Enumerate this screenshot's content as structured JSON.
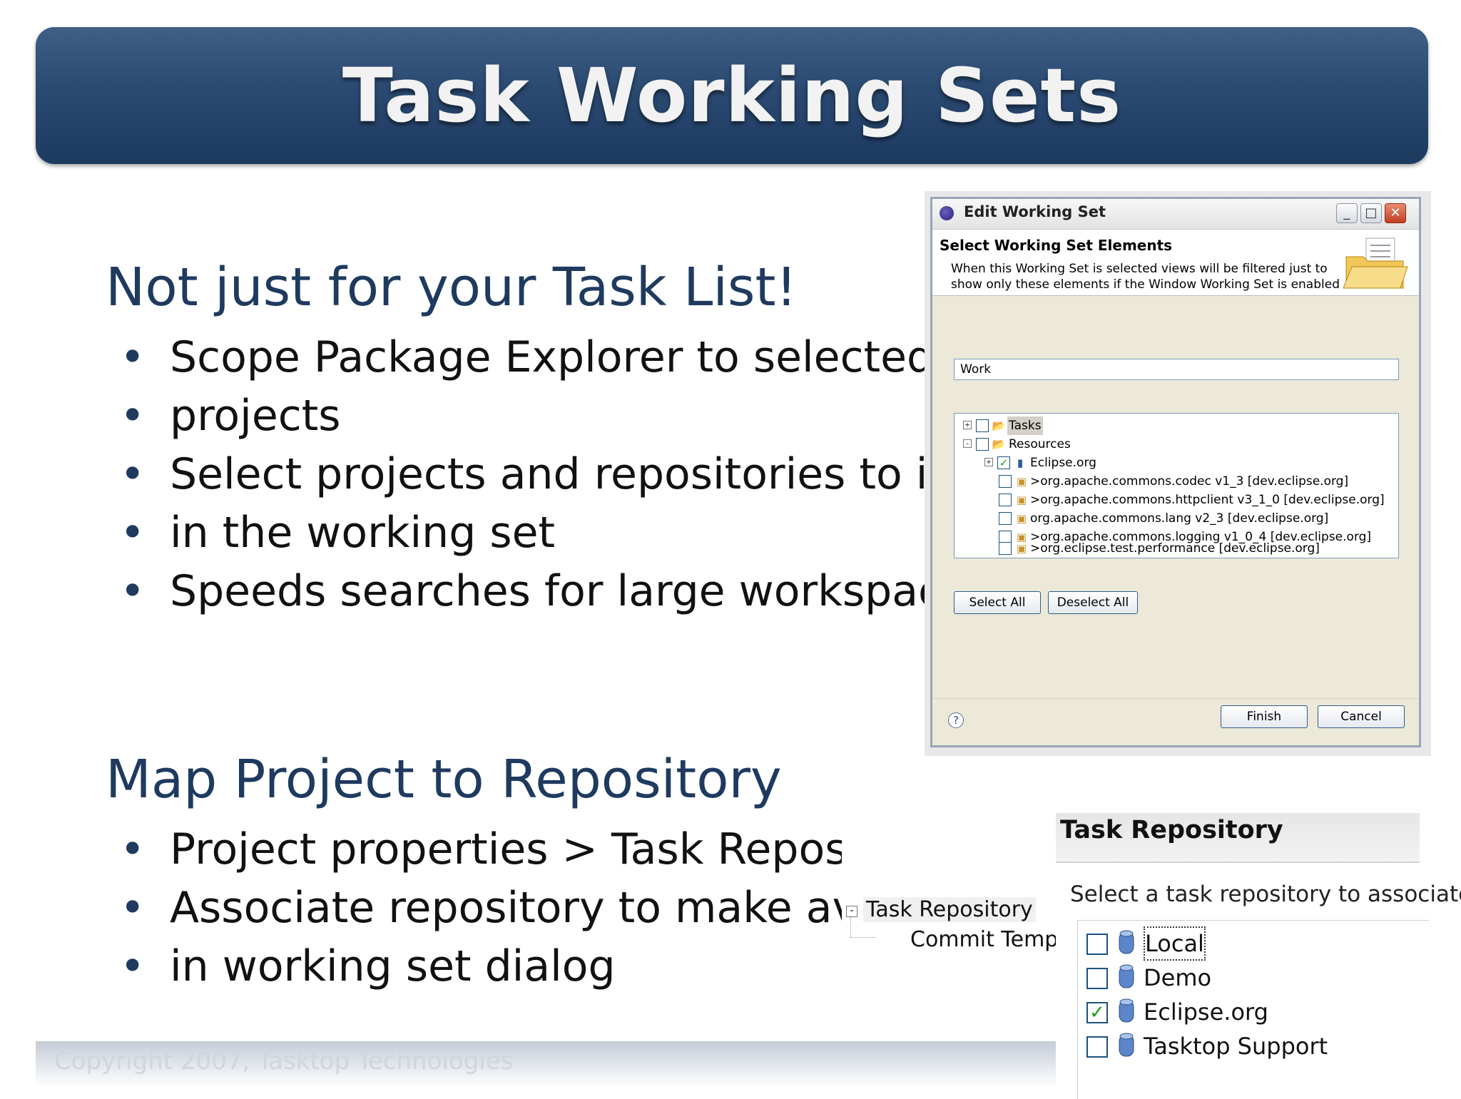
{
  "slide": {
    "title": "Task Working Sets",
    "section1": {
      "heading": "Not just for your Task List!",
      "bullets": [
        "Scope Package Explorer to selected",
        "projects",
        "Select projects and repositories to include",
        "in the working set",
        "Speeds searches for large workspaces"
      ]
    },
    "section2": {
      "heading": "Map Project to Repository",
      "bullets": [
        "Project properties > Task Repository",
        "Associate repository to make available",
        "in working set dialog"
      ]
    },
    "footer": "Copyright 2007, Tasktop Technologies"
  },
  "dialog": {
    "title": "Edit Working Set",
    "header_title": "Select Working Set Elements",
    "description": "When this Working Set is selected views will be filtered just to show only these elements if the Window Working Set is enabled",
    "name_value": "Work",
    "tree": [
      {
        "label": "Tasks",
        "checked": false,
        "expander": "+"
      },
      {
        "label": "Resources",
        "checked": false,
        "expander": "-"
      },
      {
        "label": "Eclipse.org",
        "checked": true,
        "expander": "+"
      },
      {
        "label": ">org.apache.commons.codec  v1_3 [dev.eclipse.org]",
        "checked": false
      },
      {
        "label": ">org.apache.commons.httpclient  v3_1_0 [dev.eclipse.org]",
        "checked": false
      },
      {
        "label": "org.apache.commons.lang  v2_3 [dev.eclipse.org]",
        "checked": false
      },
      {
        "label": ">org.apache.commons.logging  v1_0_4 [dev.eclipse.org]",
        "checked": false
      },
      {
        "label": ">org.eclipse.test.performance   [dev.eclipse.org]",
        "checked": false
      }
    ],
    "select_all": "Select All",
    "deselect_all": "Deselect All",
    "help": "?",
    "finish": "Finish",
    "cancel": "Cancel"
  },
  "property_tree": {
    "items": [
      "Task Repository",
      "Commit Template"
    ],
    "expander": "-"
  },
  "repo_panel": {
    "title": "Task Repository",
    "description": "Select a task repository to associate",
    "items": [
      {
        "label": "Local",
        "checked": false
      },
      {
        "label": "Demo",
        "checked": false
      },
      {
        "label": "Eclipse.org",
        "checked": true
      },
      {
        "label": "Tasktop Support",
        "checked": false
      }
    ]
  },
  "colors": {
    "banner": "#2b4a72",
    "heading_text": "#1f3a5f",
    "check": "#1a9b1a"
  }
}
